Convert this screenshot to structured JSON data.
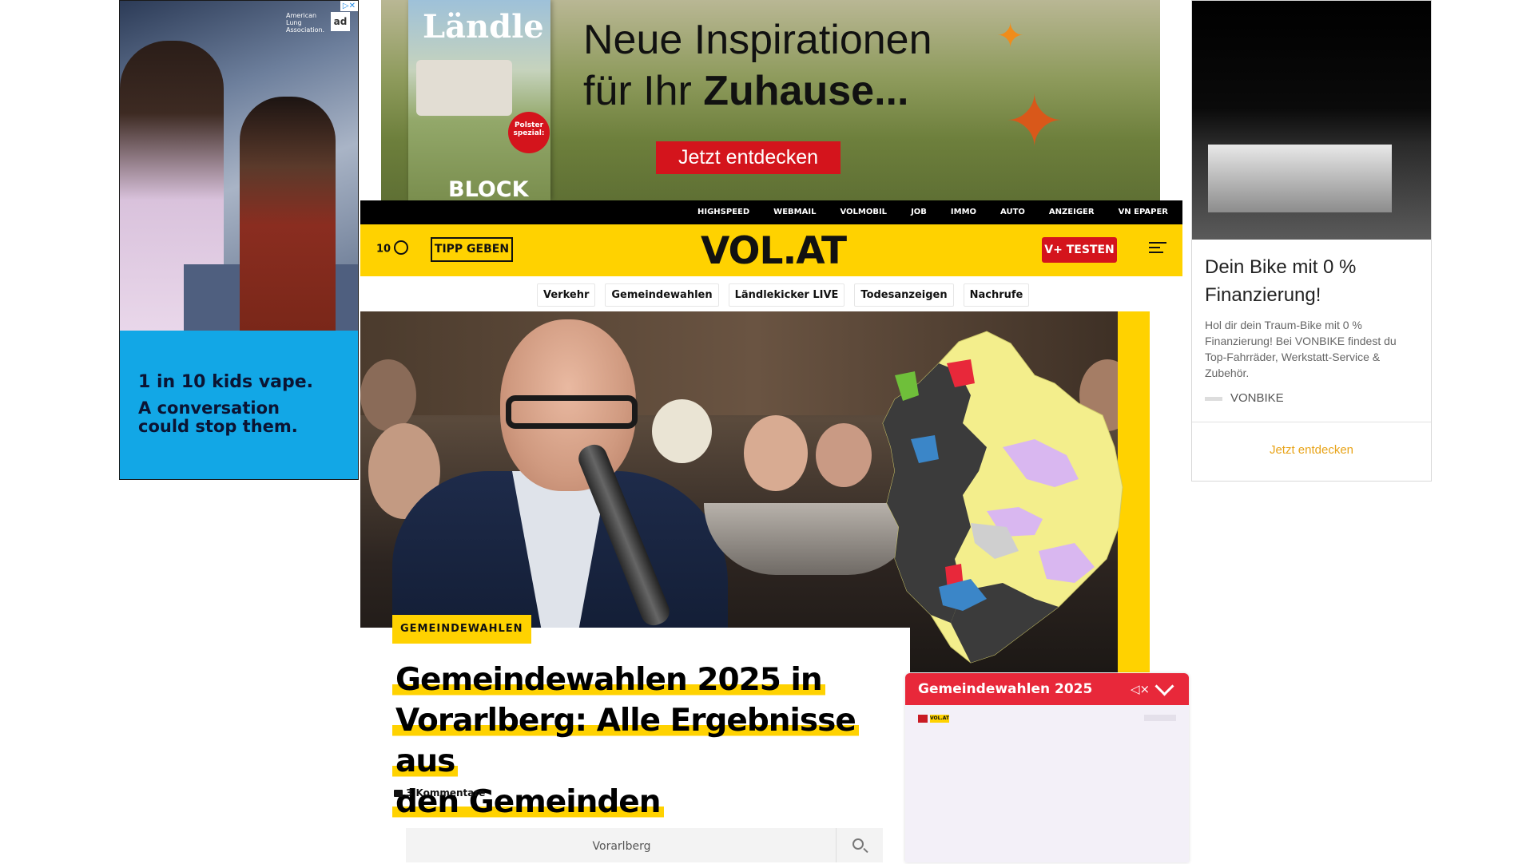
{
  "left_ad": {
    "org": "American Lung Association.",
    "ad_badge": "ad",
    "adchoices": "▷✕",
    "headline": "1 in 10 kids vape.",
    "subline": "A conversation could stop them."
  },
  "top_ad": {
    "magazine_title": "Ländle",
    "polster_badge": "Polster spezial:",
    "brand": "BLOCK",
    "line1": "Neue Inspirationen",
    "line2_plain": "für Ihr ",
    "line2_bold": "Zuhause...",
    "cta": "Jetzt entdecken",
    "butterfly_icon": "butterfly-icon"
  },
  "right_ad": {
    "title": "Dein Bike mit 0 % Finanzierung!",
    "description": "Hol dir dein Traum-Bike mit 0 % Finanzierung! Bei VONBIKE findest du Top-Fahrräder, Werkstatt-Service & Zubehör.",
    "brand": "VONBIKE",
    "cta": "Jetzt entdecken"
  },
  "topbar": {
    "links": [
      "HIGHSPEED",
      "WEBMAIL",
      "VOLMOBIL",
      "JOB",
      "IMMO",
      "AUTO",
      "ANZEIGER",
      "VN EPAPER"
    ]
  },
  "header": {
    "temperature": "10",
    "weather_icon": "weather-icon",
    "tipp_button": "TIPP GEBEN",
    "logo": "VOL.AT",
    "vplus_button": "V+ TESTEN",
    "menu_icon": "menu-search-icon"
  },
  "nav": {
    "chips": [
      "Verkehr",
      "Gemeindewahlen",
      "Ländlekicker LIVE",
      "Todesanzeigen",
      "Nachrufe"
    ]
  },
  "article": {
    "category": "GEMEINDEWAHLEN",
    "headline_lines": [
      "Gemeindewahlen 2025 in",
      "Vorarlberg: Alle Ergebnisse aus",
      "den Gemeinden"
    ],
    "comments": "3 Kommentare",
    "search_value": "Vorarlberg"
  },
  "player": {
    "title": "Gemeindewahlen 2025",
    "mute_icon": "mute-icon",
    "collapse_icon": "chevron-down-icon"
  },
  "colors": {
    "brand_yellow": "#ffd200",
    "brand_red": "#d4141c",
    "player_red": "#e8283a",
    "map_yellow": "#f3ee8c",
    "map_purple": "#d9b7f0",
    "map_dark": "#3b3b3b",
    "map_red": "#e8283a",
    "map_blue": "#3b86c8",
    "map_green": "#6fbf3a"
  }
}
